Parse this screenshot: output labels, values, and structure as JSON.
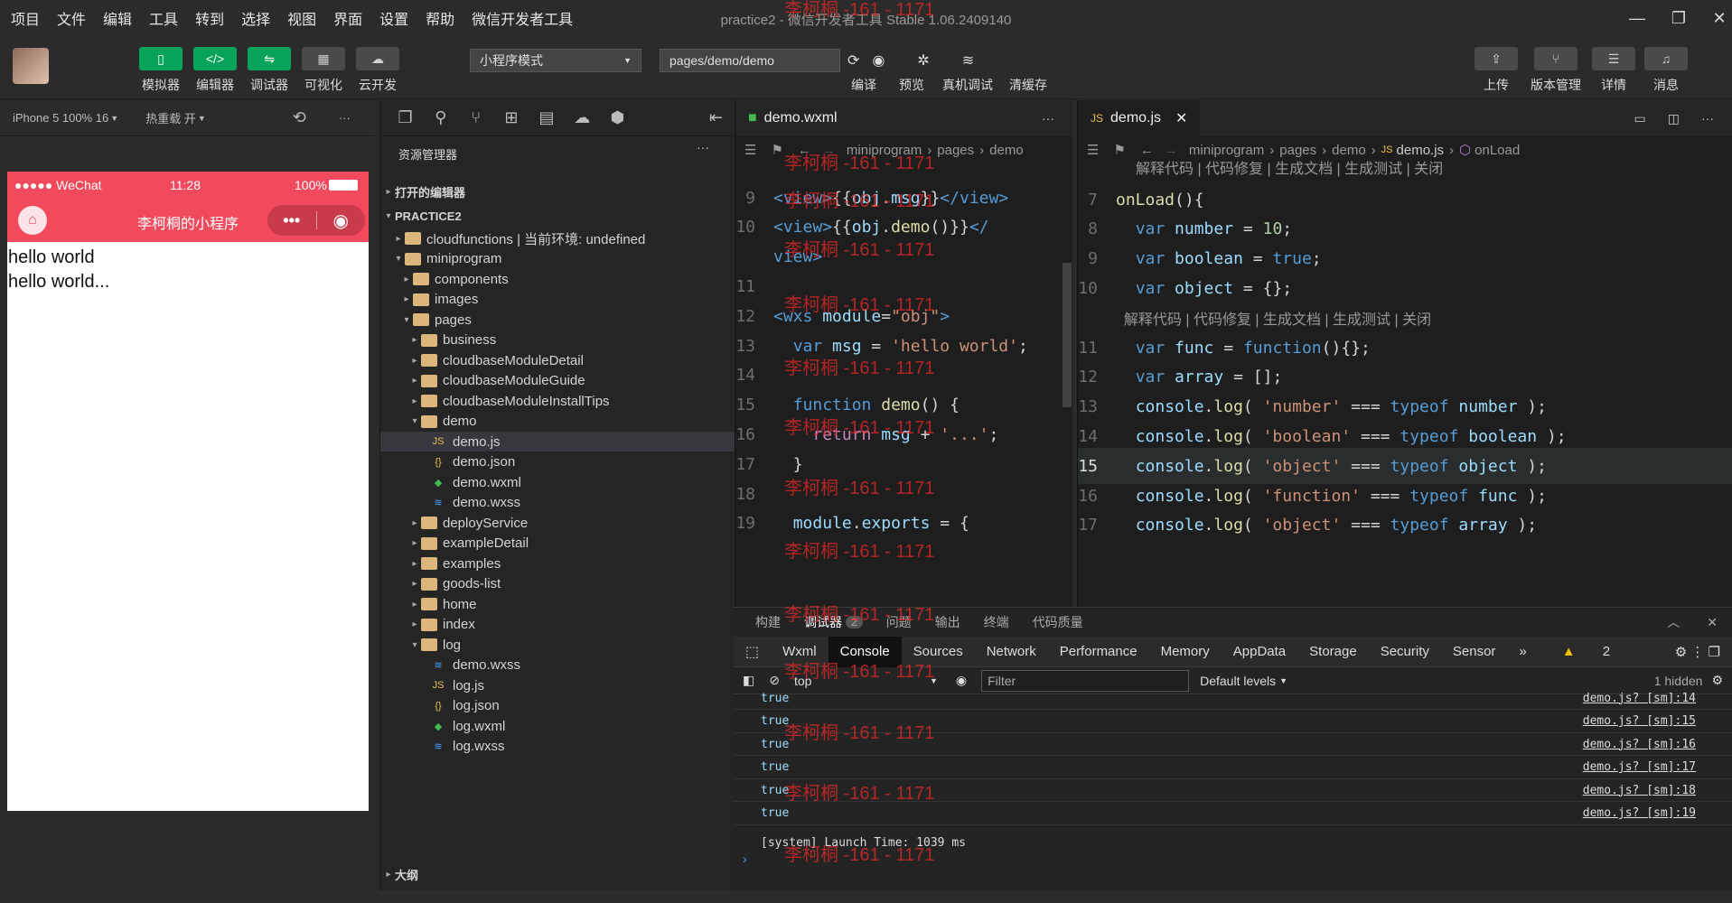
{
  "menu": [
    "项目",
    "文件",
    "编辑",
    "工具",
    "转到",
    "选择",
    "视图",
    "界面",
    "设置",
    "帮助",
    "微信开发者工具"
  ],
  "window_title": "practice2 - 微信开发者工具 Stable 1.06.2409140",
  "toolbar": {
    "buttons": [
      {
        "label": "模拟器"
      },
      {
        "label": "编辑器"
      },
      {
        "label": "调试器"
      },
      {
        "label": "可视化"
      },
      {
        "label": "云开发"
      }
    ],
    "mode": "小程序模式",
    "path": "pages/demo/demo",
    "actions": [
      {
        "label": "编译"
      },
      {
        "label": "预览"
      },
      {
        "label": "真机调试"
      },
      {
        "label": "清缓存"
      }
    ],
    "right": [
      {
        "label": "上传"
      },
      {
        "label": "版本管理"
      },
      {
        "label": "详情"
      },
      {
        "label": "消息"
      }
    ]
  },
  "sim": {
    "device": "iPhone 5 100% 16",
    "hotreload": "热重载 开",
    "status_carrier": "●●●●● WeChat",
    "status_time": "11:28",
    "status_battery": "100%",
    "nav_title": "李柯桐的小程序",
    "content": [
      "hello world",
      "hello world..."
    ]
  },
  "explorer": {
    "title": "资源管理器",
    "open_editors": "打开的编辑器",
    "project": "PRACTICE2",
    "items": [
      {
        "label": "cloudfunctions | 当前环境: undefined",
        "depth": 1,
        "arrow": "▸",
        "icon": "folder"
      },
      {
        "label": "miniprogram",
        "depth": 1,
        "arrow": "▾",
        "icon": "folder"
      },
      {
        "label": "components",
        "depth": 2,
        "arrow": "▸",
        "icon": "folder"
      },
      {
        "label": "images",
        "depth": 2,
        "arrow": "▸",
        "icon": "folder"
      },
      {
        "label": "pages",
        "depth": 2,
        "arrow": "▾",
        "icon": "folder"
      },
      {
        "label": "business",
        "depth": 3,
        "arrow": "▸",
        "icon": "folder"
      },
      {
        "label": "cloudbaseModuleDetail",
        "depth": 3,
        "arrow": "▸",
        "icon": "folder"
      },
      {
        "label": "cloudbaseModuleGuide",
        "depth": 3,
        "arrow": "▸",
        "icon": "folder"
      },
      {
        "label": "cloudbaseModuleInstallTips",
        "depth": 3,
        "arrow": "▸",
        "icon": "folder"
      },
      {
        "label": "demo",
        "depth": 3,
        "arrow": "▾",
        "icon": "folder"
      },
      {
        "label": "demo.js",
        "depth": 4,
        "arrow": "",
        "icon": "js"
      },
      {
        "label": "demo.json",
        "depth": 4,
        "arrow": "",
        "icon": "json"
      },
      {
        "label": "demo.wxml",
        "depth": 4,
        "arrow": "",
        "icon": "wxml"
      },
      {
        "label": "demo.wxss",
        "depth": 4,
        "arrow": "",
        "icon": "wxss"
      },
      {
        "label": "deployService",
        "depth": 3,
        "arrow": "▸",
        "icon": "folder"
      },
      {
        "label": "exampleDetail",
        "depth": 3,
        "arrow": "▸",
        "icon": "folder"
      },
      {
        "label": "examples",
        "depth": 3,
        "arrow": "▸",
        "icon": "folder"
      },
      {
        "label": "goods-list",
        "depth": 3,
        "arrow": "▸",
        "icon": "folder"
      },
      {
        "label": "home",
        "depth": 3,
        "arrow": "▸",
        "icon": "folder"
      },
      {
        "label": "index",
        "depth": 3,
        "arrow": "▸",
        "icon": "folder"
      },
      {
        "label": "log",
        "depth": 3,
        "arrow": "▾",
        "icon": "folder"
      },
      {
        "label": "demo.wxss",
        "depth": 4,
        "arrow": "",
        "icon": "wxss"
      },
      {
        "label": "log.js",
        "depth": 4,
        "arrow": "",
        "icon": "js"
      },
      {
        "label": "log.json",
        "depth": 4,
        "arrow": "",
        "icon": "json"
      },
      {
        "label": "log.wxml",
        "depth": 4,
        "arrow": "",
        "icon": "wxml"
      },
      {
        "label": "log.wxss",
        "depth": 4,
        "arrow": "",
        "icon": "wxss"
      }
    ],
    "outline": "大纲"
  },
  "editor1": {
    "tab": "demo.wxml",
    "crumb": [
      "miniprogram",
      "pages",
      "demo"
    ],
    "lines": [
      {
        "n": "9",
        "t": "<view>{{obj.msg}}</view>"
      },
      {
        "n": "10",
        "t": "<view>{{obj.demo()}}</"
      },
      {
        "n": "",
        "t": "view>"
      },
      {
        "n": "11",
        "t": ""
      },
      {
        "n": "12",
        "t": "<wxs module=\"obj\">"
      },
      {
        "n": "13",
        "t": "  var msg = 'hello world';"
      },
      {
        "n": "14",
        "t": ""
      },
      {
        "n": "15",
        "t": "  function demo() {"
      },
      {
        "n": "16",
        "t": "    return msg + '...';"
      },
      {
        "n": "17",
        "t": "  }"
      },
      {
        "n": "18",
        "t": ""
      },
      {
        "n": "19",
        "t": "  module.exports = {"
      }
    ]
  },
  "editor2": {
    "tab": "demo.js",
    "crumb": [
      "miniprogram",
      "pages",
      "demo",
      "demo.js",
      "onLoad"
    ],
    "codelens": "解释代码 | 代码修复 | 生成文档 | 生成测试 | 关闭",
    "lines": [
      {
        "n": "7",
        "t": "onLoad(){"
      },
      {
        "n": "8",
        "t": "  var number = 10;"
      },
      {
        "n": "9",
        "t": "  var boolean = true;"
      },
      {
        "n": "10",
        "t": "  var object = {};"
      },
      {
        "n": "",
        "t": "  解释代码 | 代码修复 | 生成文档 | 生成测试 | 关闭"
      },
      {
        "n": "11",
        "t": "  var func = function(){};"
      },
      {
        "n": "12",
        "t": "  var array = [];"
      },
      {
        "n": "13",
        "t": "  console.log( 'number' === typeof number );"
      },
      {
        "n": "14",
        "t": "  console.log( 'boolean' === typeof boolean );"
      },
      {
        "n": "15",
        "t": "  console.log( 'object' === typeof object );"
      },
      {
        "n": "16",
        "t": "  console.log( 'function' === typeof func );"
      },
      {
        "n": "17",
        "t": "  console.log( 'object' === typeof array );"
      }
    ]
  },
  "panel": {
    "tabs": [
      "构建",
      "调试器",
      "问题",
      "输出",
      "终端",
      "代码质量"
    ],
    "debugger_badge": "2",
    "devtabs": [
      "Wxml",
      "Console",
      "Sources",
      "Network",
      "Performance",
      "Memory",
      "AppData",
      "Storage",
      "Security",
      "Sensor"
    ],
    "warn": "2",
    "context": "top",
    "filter": "Filter",
    "levels": "Default levels",
    "hidden": "1 hidden",
    "logs": [
      {
        "v": "true",
        "src": "demo.js? [sm]:14"
      },
      {
        "v": "true",
        "src": "demo.js? [sm]:15"
      },
      {
        "v": "true",
        "src": "demo.js? [sm]:16"
      },
      {
        "v": "true",
        "src": "demo.js? [sm]:17"
      },
      {
        "v": "true",
        "src": "demo.js? [sm]:18"
      },
      {
        "v": "true",
        "src": "demo.js? [sm]:19"
      }
    ],
    "system": "[system] Launch Time: 1039 ms"
  },
  "watermark": "李柯桐 -161 - 1171",
  "colors": {
    "accent": "#07a35a",
    "nav": "#f04a5c"
  }
}
